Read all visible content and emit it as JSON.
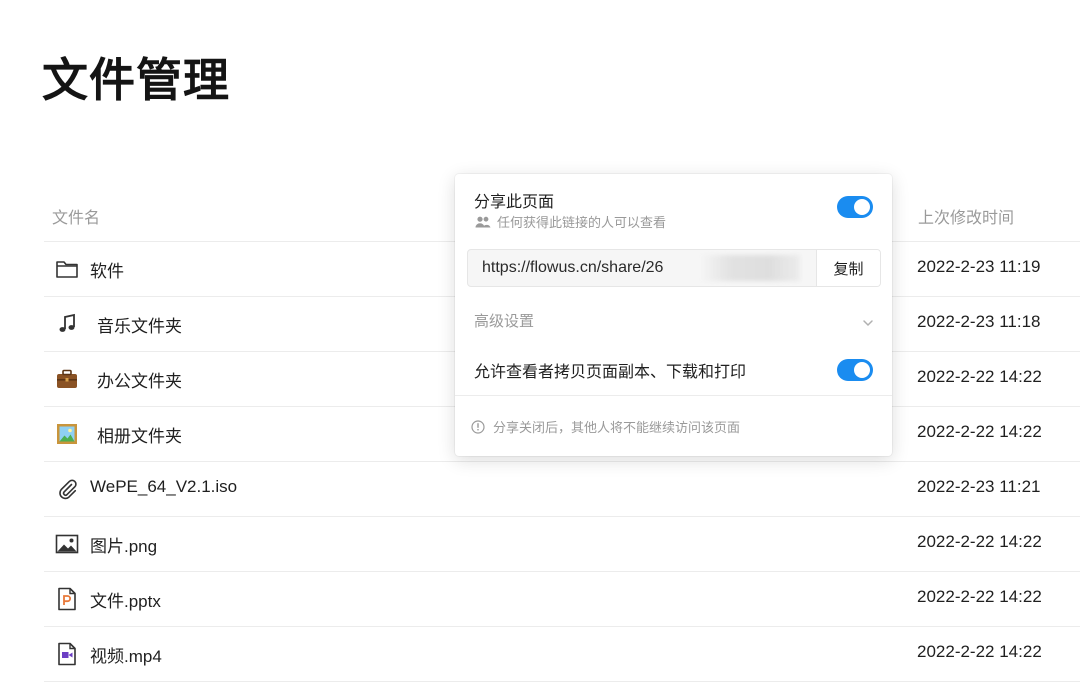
{
  "page": {
    "title": "文件管理"
  },
  "table": {
    "headers": {
      "name": "文件名",
      "modified": "上次修改时间"
    },
    "rows": [
      {
        "icon": "folder-icon",
        "name": "软件",
        "modified": "2022-2-23 11:19"
      },
      {
        "icon": "music-note-icon",
        "name": "音乐文件夹",
        "modified": "2022-2-23 11:18"
      },
      {
        "icon": "briefcase-icon",
        "name": "办公文件夹",
        "modified": "2022-2-22 14:22"
      },
      {
        "icon": "picture-frame-icon",
        "name": "相册文件夹",
        "modified": "2022-2-22 14:22"
      },
      {
        "icon": "paperclip-icon",
        "name": "WePE_64_V2.1.iso",
        "modified": "2022-2-23 11:21"
      },
      {
        "icon": "image-file-icon",
        "name": "图片.png",
        "modified": "2022-2-22 14:22"
      },
      {
        "icon": "pptx-file-icon",
        "name": "文件.pptx",
        "modified": "2022-2-22 14:22"
      },
      {
        "icon": "video-file-icon",
        "name": "视频.mp4",
        "modified": "2022-2-22 14:22"
      }
    ]
  },
  "share": {
    "title": "分享此页面",
    "subtitle": "任何获得此链接的人可以查看",
    "share_enabled": true,
    "link": "https://flowus.cn/share/26",
    "copy_label": "复制",
    "advanced_label": "高级设置",
    "allow_copy_label": "允许查看者拷贝页面副本、下载和打印",
    "allow_copy_enabled": true,
    "notice": "分享关闭后，其他人将不能继续访问该页面"
  },
  "colors": {
    "accent": "#1a8cf0",
    "muted_text": "#9a9a9a",
    "divider": "#ececec"
  }
}
